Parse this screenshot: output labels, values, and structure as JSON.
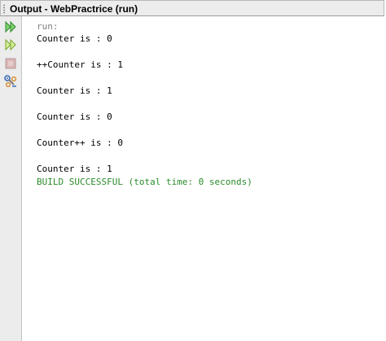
{
  "window": {
    "title": "Output - WebPractrice (run)"
  },
  "toolbar": {
    "items": [
      {
        "icon": "rerun-icon",
        "color": "#3aa63a"
      },
      {
        "icon": "rerun-with-options-icon",
        "color": "#3aa63a"
      },
      {
        "icon": "stop-icon",
        "color": "#c9a4a4"
      },
      {
        "icon": "settings-icon",
        "color": "#4a78c8"
      }
    ]
  },
  "output": {
    "run_label": "run:",
    "lines": [
      "Counter is : 0",
      "++Counter is : 1",
      "Counter is : 1",
      "Counter is : 0",
      "Counter++ is : 0",
      "Counter is : 1"
    ],
    "status": "BUILD SUCCESSFUL (total time: 0 seconds)"
  },
  "colors": {
    "run": "#808080",
    "text": "#000000",
    "success": "#2b8a2b"
  }
}
